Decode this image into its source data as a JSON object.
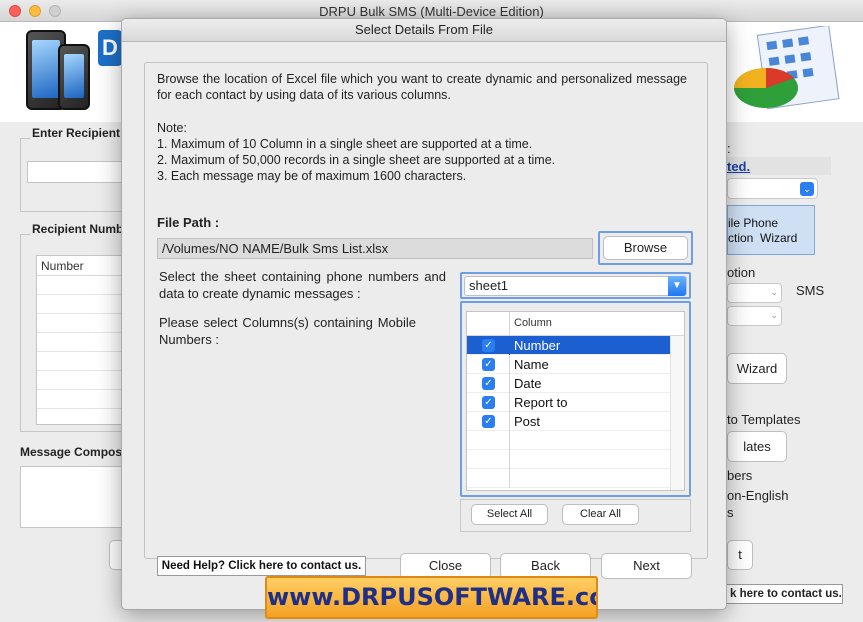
{
  "app": {
    "title": "DRPU Bulk SMS (Multi-Device Edition)",
    "logo_letter": "D"
  },
  "background": {
    "enter_recipient_label": "Enter Recipient",
    "recipient_numbers_label": "Recipient Numb",
    "number_header": "Number",
    "message_compose_label": "Message Compos",
    "right_colon": ":",
    "right_link": "ted.",
    "mobile_phone_btn": "ile Phone\nction  Wizard",
    "option_label": "otion",
    "sms_label": "SMS",
    "wizard_btn": "Wizard",
    "to_templates": "to Templates",
    "lates_btn": "lates",
    "bers_label": "bers",
    "non_english_label": "on-English",
    "s_label": "s",
    "t_btn": "t",
    "contact_text": "k here to contact us."
  },
  "dialog": {
    "title": "Select Details From File",
    "description": "Browse the location of Excel file which you want to create dynamic and personalized message for each contact by using data of its various columns.",
    "note_title": "Note:",
    "notes": [
      "1. Maximum of 10 Column in a single sheet are supported at a time.",
      "2. Maximum of 50,000 records in a single sheet are supported at a time.",
      "3. Each message may be of maximum 1600 characters."
    ],
    "file_path_label": "File Path :",
    "file_path_value": "/Volumes/NO NAME/Bulk Sms List.xlsx",
    "browse_label": "Browse",
    "select_sheet_label": "Select the sheet containing phone numbers and data to create dynamic messages :",
    "sheet_selected": "sheet1",
    "select_columns_label": "Please select Columns(s) containing Mobile Numbers :",
    "column_header": "Column",
    "columns": [
      {
        "name": "Number",
        "checked": true,
        "selected": true
      },
      {
        "name": "Name",
        "checked": true,
        "selected": false
      },
      {
        "name": "Date",
        "checked": true,
        "selected": false
      },
      {
        "name": "Report to",
        "checked": true,
        "selected": false
      },
      {
        "name": "Post",
        "checked": true,
        "selected": false
      }
    ],
    "select_all_label": "Select All",
    "clear_all_label": "Clear All",
    "help_label": "Need Help? Click here to contact us.",
    "close_label": "Close",
    "back_label": "Back",
    "next_label": "Next"
  },
  "watermark": "www.DRPUSOFTWARE.com",
  "colors": {
    "selection": "#1c5fd0",
    "focus_ring": "#6d9ee6",
    "checkbox": "#2b7ef0",
    "watermark_bg": "#f4a125",
    "watermark_text": "#1f2f86"
  }
}
